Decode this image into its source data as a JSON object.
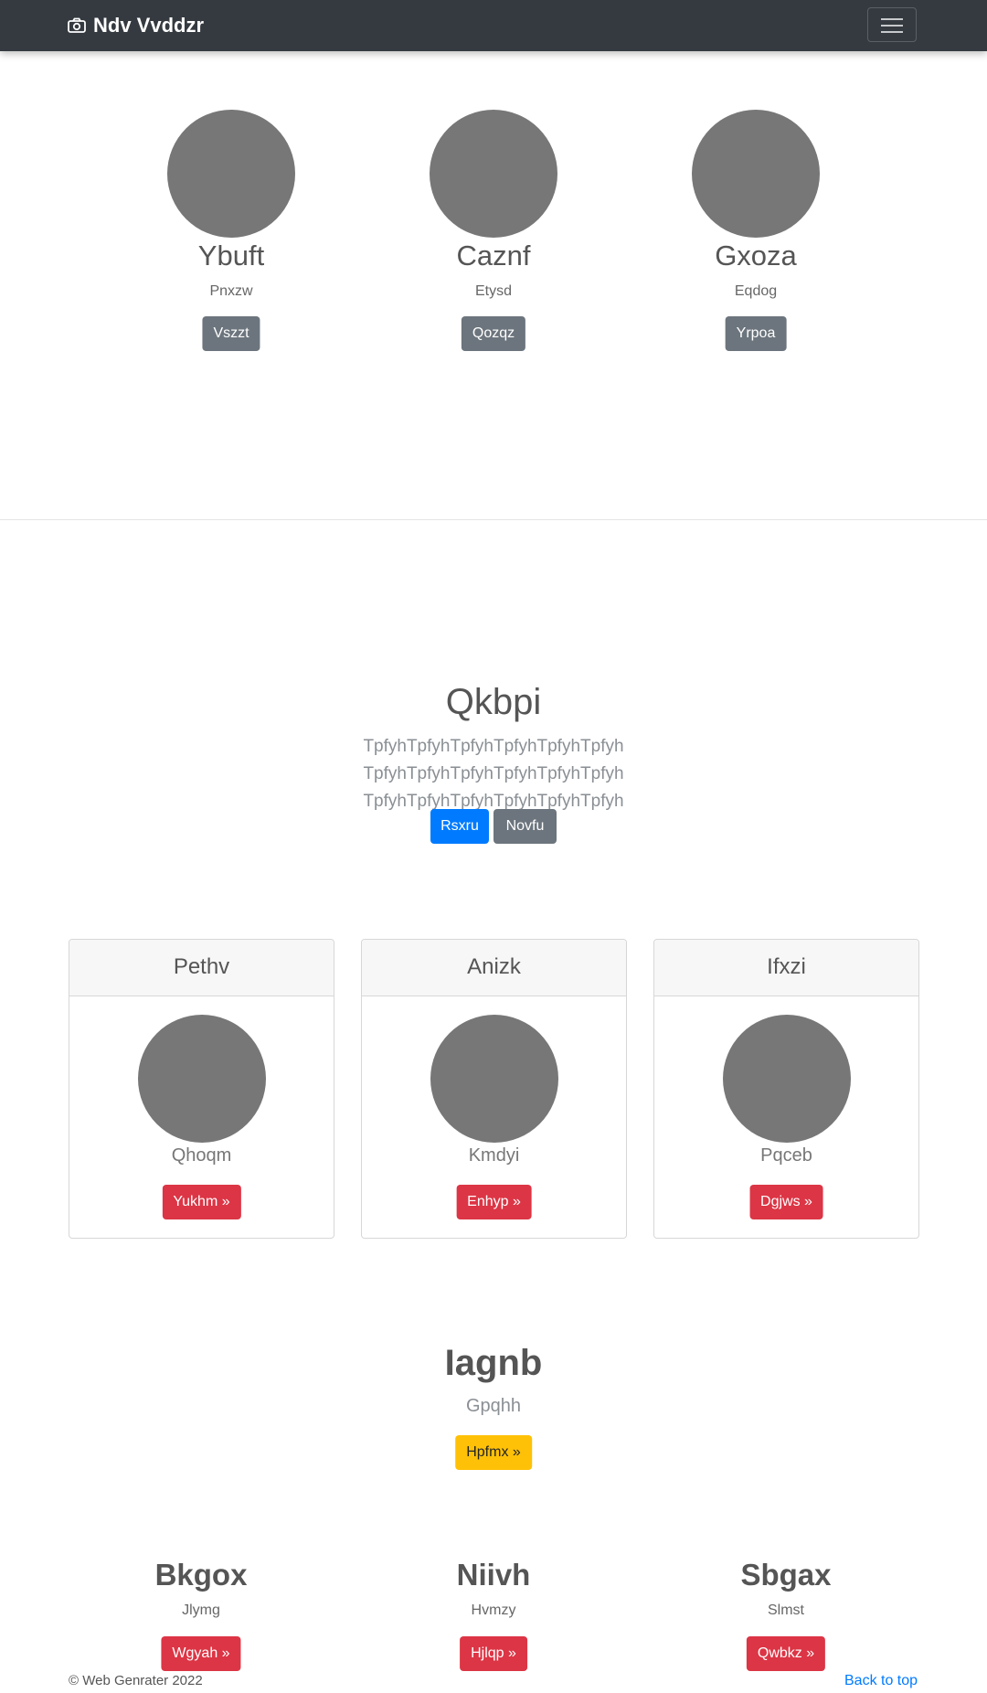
{
  "nav": {
    "brand": "Ndv Vvddzr"
  },
  "team": [
    {
      "name": "Ybuft",
      "role": "Pnxzw",
      "button": "Vszzt"
    },
    {
      "name": "Caznf",
      "role": "Etysd",
      "button": "Qozqz"
    },
    {
      "name": "Gxoza",
      "role": "Eqdog",
      "button": "Yrpoa"
    }
  ],
  "hero": {
    "title": "Qkbpi",
    "text": "TpfyhTpfyhTpfyhTpfyhTpfyhTpfyh TpfyhTpfyhTpfyhTpfyhTpfyhTpfyh TpfyhTpfyhTpfyhTpfyhTpfyhTpfyh",
    "primary": "Rsxru",
    "secondary": "Novfu"
  },
  "cards": [
    {
      "header": "Pethv",
      "caption": "Qhoqm",
      "button": "Yukhm »"
    },
    {
      "header": "Anizk",
      "caption": "Kmdyi",
      "button": "Enhyp »"
    },
    {
      "header": "Ifxzi",
      "caption": "Pqceb",
      "button": "Dgjws »"
    }
  ],
  "feature": {
    "title": "Iagnb",
    "subtitle": "Gpqhh",
    "button": "Hpfmx »"
  },
  "columns": [
    {
      "title": "Bkgox",
      "subtitle": "Jlymg",
      "button": "Wgyah »"
    },
    {
      "title": "Niivh",
      "subtitle": "Hvmzy",
      "button": "Hjlqp »"
    },
    {
      "title": "Sbgax",
      "subtitle": "Slmst",
      "button": "Qwbkz »"
    }
  ],
  "footer": {
    "copyright": "© Web Genrater 2022",
    "back_to_top": "Back to top"
  },
  "colors": {
    "navbar": "#343a40",
    "primary": "#007bff",
    "secondary": "#6c757d",
    "danger": "#dc3545",
    "warning": "#ffc107",
    "placeholder": "#777777"
  },
  "icons": {
    "brand": "camera-icon",
    "menu": "hamburger-menu-icon"
  }
}
